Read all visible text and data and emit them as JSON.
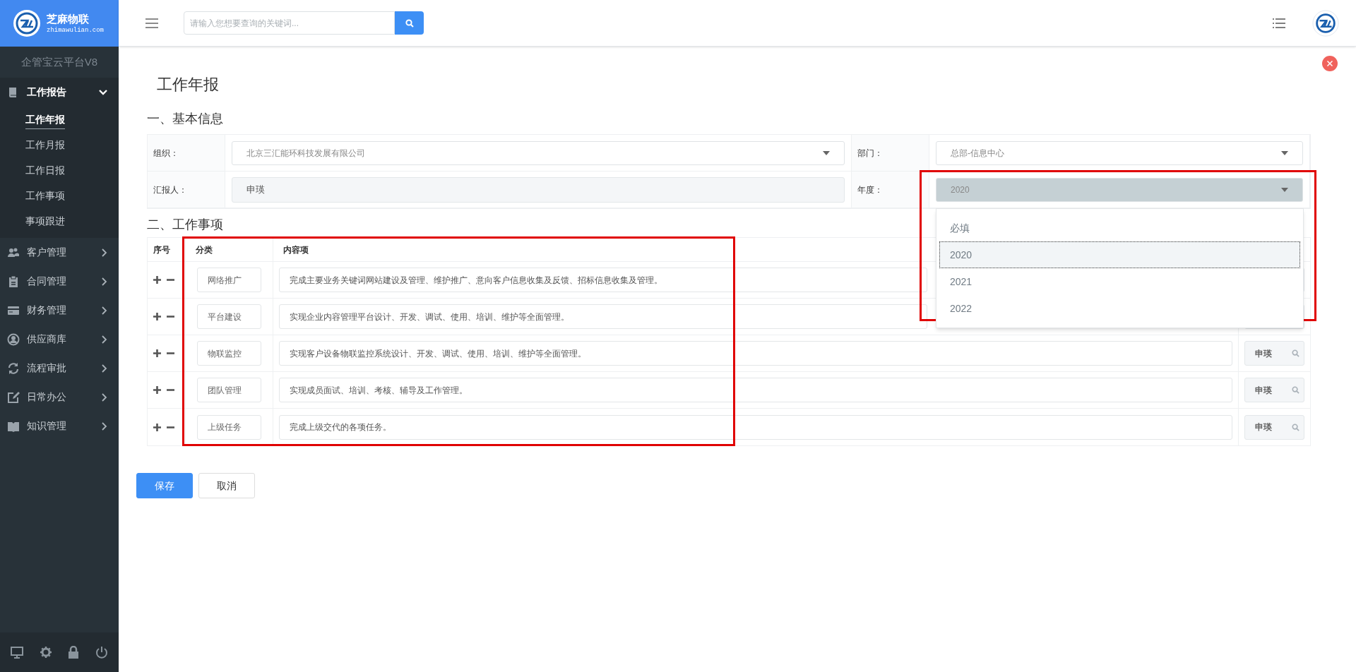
{
  "brand": {
    "name": "芝麻物联",
    "domain": "zhimawulian.com"
  },
  "search": {
    "placeholder": "请输入您想要查询的关键词..."
  },
  "platform_title": "企管宝云平台V8",
  "sidebar": {
    "items": [
      {
        "label": "工作报告",
        "expanded": true,
        "children": [
          {
            "label": "工作年报",
            "selected": true
          },
          {
            "label": "工作月报",
            "selected": false
          },
          {
            "label": "工作日报",
            "selected": false
          },
          {
            "label": "工作事项",
            "selected": false
          },
          {
            "label": "事项跟进",
            "selected": false
          }
        ]
      },
      {
        "label": "客户管理",
        "expanded": false
      },
      {
        "label": "合同管理",
        "expanded": false
      },
      {
        "label": "财务管理",
        "expanded": false
      },
      {
        "label": "供应商库",
        "expanded": false
      },
      {
        "label": "流程审批",
        "expanded": false
      },
      {
        "label": "日常办公",
        "expanded": false
      },
      {
        "label": "知识管理",
        "expanded": false
      }
    ]
  },
  "page_title": "工作年报",
  "basic_info": {
    "heading": "一、基本信息",
    "fields": [
      {
        "label": "组织：",
        "value": "北京三汇能环科技发展有限公司",
        "kind": "select"
      },
      {
        "label": "部门：",
        "value": "总部-信息中心",
        "kind": "select"
      },
      {
        "label": "汇报人：",
        "value": "申瑛",
        "kind": "readonly"
      },
      {
        "label": "年度：",
        "value": "2020",
        "kind": "select",
        "open": true,
        "options": [
          {
            "label": "必填",
            "selected": false
          },
          {
            "label": "2020",
            "selected": true
          },
          {
            "label": "2021",
            "selected": false
          },
          {
            "label": "2022",
            "selected": false
          }
        ]
      }
    ]
  },
  "work_items": {
    "heading": "二、工作事项",
    "columns": [
      "序号",
      "分类",
      "内容项"
    ],
    "rows": [
      {
        "category": "网络推广",
        "content": "完成主要业务关键词网站建设及管理、维护推广、意向客户信息收集及反馈、招标信息收集及管理。"
      },
      {
        "category": "平台建设",
        "content": "实现企业内容管理平台设计、开发、调试、使用、培训、维护等全面管理。"
      },
      {
        "category": "物联监控",
        "content": "实现客户设备物联监控系统设计、开发、调试、使用、培训、维护等全面管理。",
        "assignee": "申瑛"
      },
      {
        "category": "团队管理",
        "content": "实现成员面试、培训、考核、辅导及工作管理。",
        "assignee": "申瑛"
      },
      {
        "category": "上级任务",
        "content": "完成上级交代的各项任务。",
        "assignee": "申瑛"
      }
    ]
  },
  "buttons": [
    {
      "label": "保存",
      "kind": "primary"
    },
    {
      "label": "取消",
      "kind": "default"
    }
  ]
}
